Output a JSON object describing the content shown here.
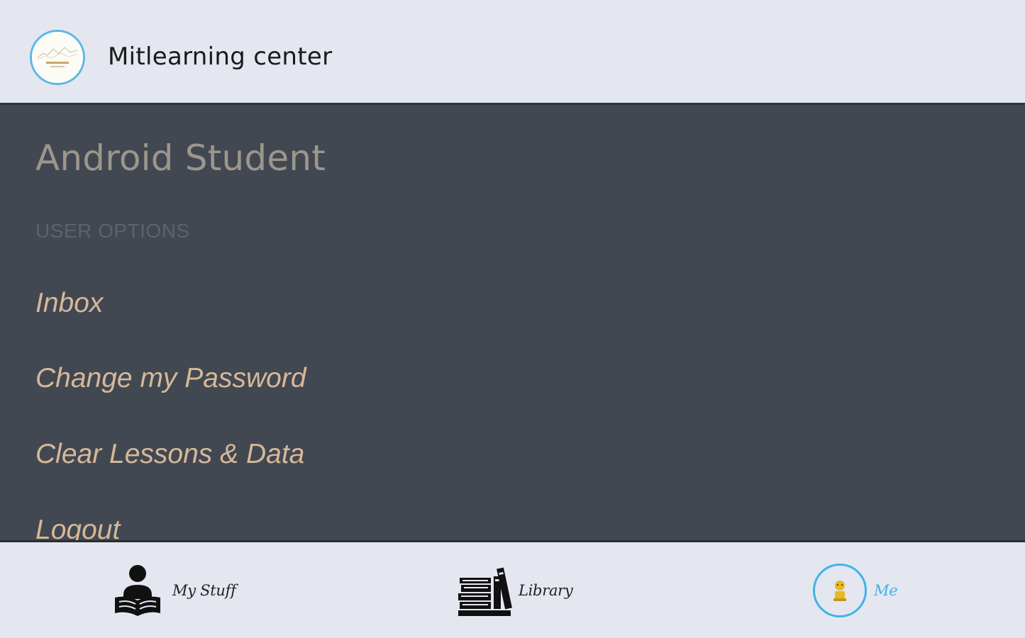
{
  "header": {
    "center_name": "Mitlearning center",
    "logo_icon": "center-logo-icon"
  },
  "profile": {
    "student_name": "Android Student",
    "section_label": "USER OPTIONS"
  },
  "menu": {
    "items": [
      {
        "label": "Inbox"
      },
      {
        "label": "Change my Password"
      },
      {
        "label": "Clear Lessons & Data"
      },
      {
        "label": "Logout"
      }
    ]
  },
  "bottom_nav": {
    "items": [
      {
        "label": "My Stuff",
        "icon": "reader-icon",
        "active": false
      },
      {
        "label": "Library",
        "icon": "books-icon",
        "active": false
      },
      {
        "label": "Me",
        "icon": "user-avatar-icon",
        "active": true
      }
    ]
  },
  "colors": {
    "header_bg": "#e4e7ef",
    "panel_bg": "#414852",
    "student_name": "#9d968c",
    "section_label": "#5b636e",
    "menu_item": "#d6b898",
    "accent": "#3fb3e8"
  }
}
